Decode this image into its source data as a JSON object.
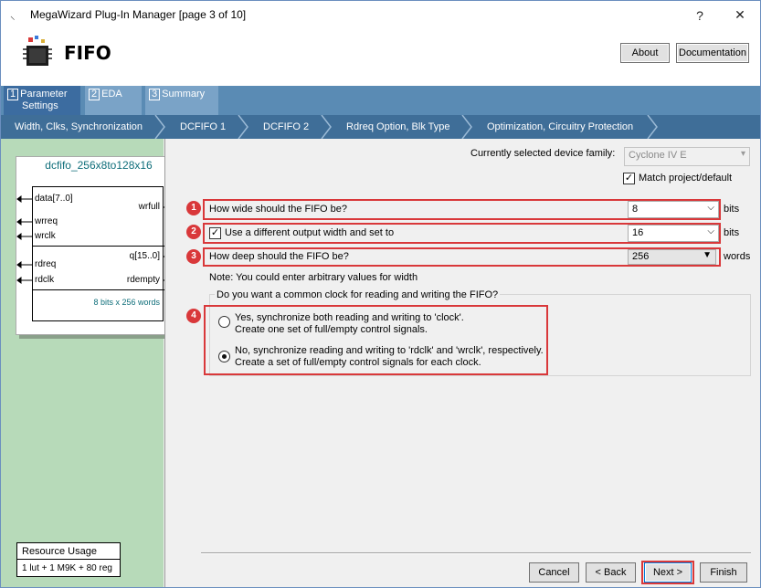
{
  "window": {
    "title": "MegaWizard Plug-In Manager [page 3 of 10]",
    "help": "?",
    "close": "✕"
  },
  "header": {
    "title": "FIFO",
    "about_label": "About",
    "documentation_label": "Documentation"
  },
  "tabs": [
    {
      "num": "1",
      "label": "Parameter",
      "label2": "Settings"
    },
    {
      "num": "2",
      "label": "EDA"
    },
    {
      "num": "3",
      "label": "Summary"
    }
  ],
  "subnav": [
    "Width, Clks, Synchronization",
    "DCFIFO 1",
    "DCFIFO 2",
    "Rdreq Option, Blk Type",
    "Optimization, Circuitry Protection"
  ],
  "block": {
    "title": "dcfifo_256x8to128x16",
    "inputs_top": [
      "data[7..0]",
      "wrreq",
      "wrclk"
    ],
    "output_top": "wrfull",
    "inputs_bottom": [
      "rdreq",
      "rdclk"
    ],
    "outputs_bottom": [
      "q[15..0]",
      "rdempty"
    ],
    "caption": "8 bits x 256 words"
  },
  "resource": {
    "title": "Resource Usage",
    "value": "1 lut + 1 M9K + 80 reg"
  },
  "device": {
    "label": "Currently selected device family:",
    "value": "Cyclone IV E",
    "match_label": "Match project/default"
  },
  "q1": {
    "badge": "1",
    "label": "How wide should the FIFO be?",
    "value": "8",
    "unit": "bits"
  },
  "q2": {
    "badge": "2",
    "label": "Use a different output width and set to",
    "value": "16",
    "unit": "bits"
  },
  "q3": {
    "badge": "3",
    "label": "How deep should the FIFO be?",
    "value": "256",
    "unit": "words"
  },
  "note": "Note: You could enter arbitrary values for width",
  "clock": {
    "badge": "4",
    "group_label": "Do you want a common clock for reading and writing the FIFO?",
    "opt1_line1": "Yes, synchronize both reading and writing to 'clock'.",
    "opt1_line2": "Create one set of full/empty control signals.",
    "opt2_line1": "No, synchronize reading and writing to 'rdclk' and 'wrclk', respectively.",
    "opt2_line2": "Create a set of full/empty control signals for each clock."
  },
  "footer": {
    "cancel": "Cancel",
    "back": "< Back",
    "next": "Next >",
    "finish": "Finish"
  },
  "colors": {
    "highlight": "#d9383a",
    "tab_bar": "#5a8bb4",
    "left_pane": "#b7dab9"
  }
}
